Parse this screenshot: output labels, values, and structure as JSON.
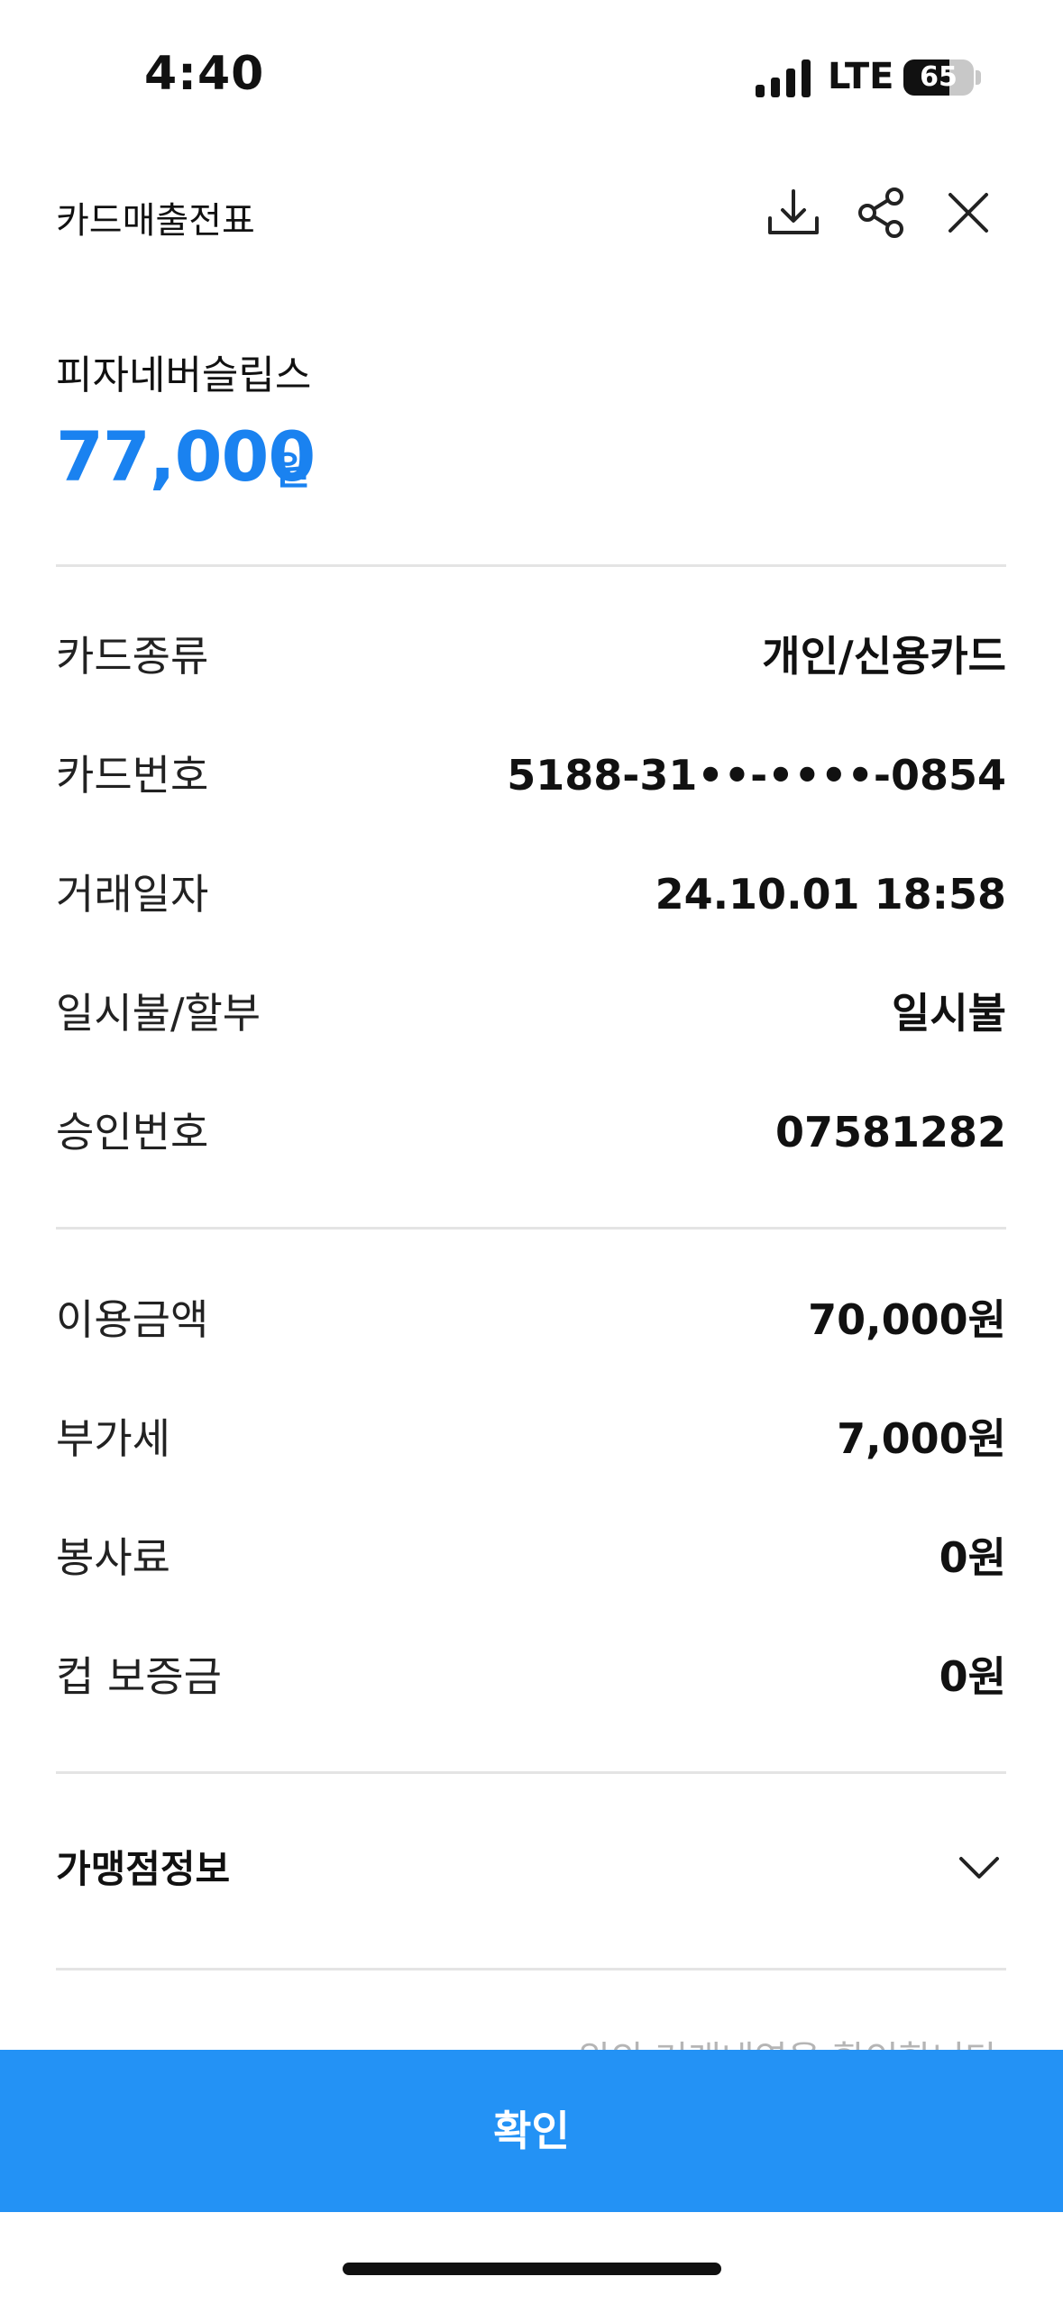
{
  "status_bar": {
    "time": "4:40",
    "network": "LTE",
    "battery": "65"
  },
  "header": {
    "title": "카드매출전표",
    "icons": [
      "download-icon",
      "share-icon",
      "close-icon"
    ]
  },
  "merchant": {
    "name": "피자네버슬립스",
    "amount": "77,000",
    "currency": "원"
  },
  "card_details": [
    {
      "label": "카드종류",
      "value": "개인/신용카드"
    },
    {
      "label": "카드번호",
      "value": "5188-31••-••••-0854"
    },
    {
      "label": "거래일자",
      "value": "24.10.01 18:58"
    },
    {
      "label": "일시불/할부",
      "value": "일시불"
    },
    {
      "label": "승인번호",
      "value": "07581282"
    }
  ],
  "amount_details": [
    {
      "label": "이용금액",
      "value": "70,000원"
    },
    {
      "label": "부가세",
      "value": "7,000원"
    },
    {
      "label": "봉사료",
      "value": "0원"
    },
    {
      "label": "컵 보증금",
      "value": "0원"
    }
  ],
  "merchant_info": {
    "label": "가맹점정보"
  },
  "footer": {
    "faded_note": "위의 거래내역을 확인합니다",
    "confirm_label": "확인"
  },
  "colors": {
    "accent": "#1a82f0",
    "button": "#2392f5",
    "divider": "#e4e4e4"
  }
}
